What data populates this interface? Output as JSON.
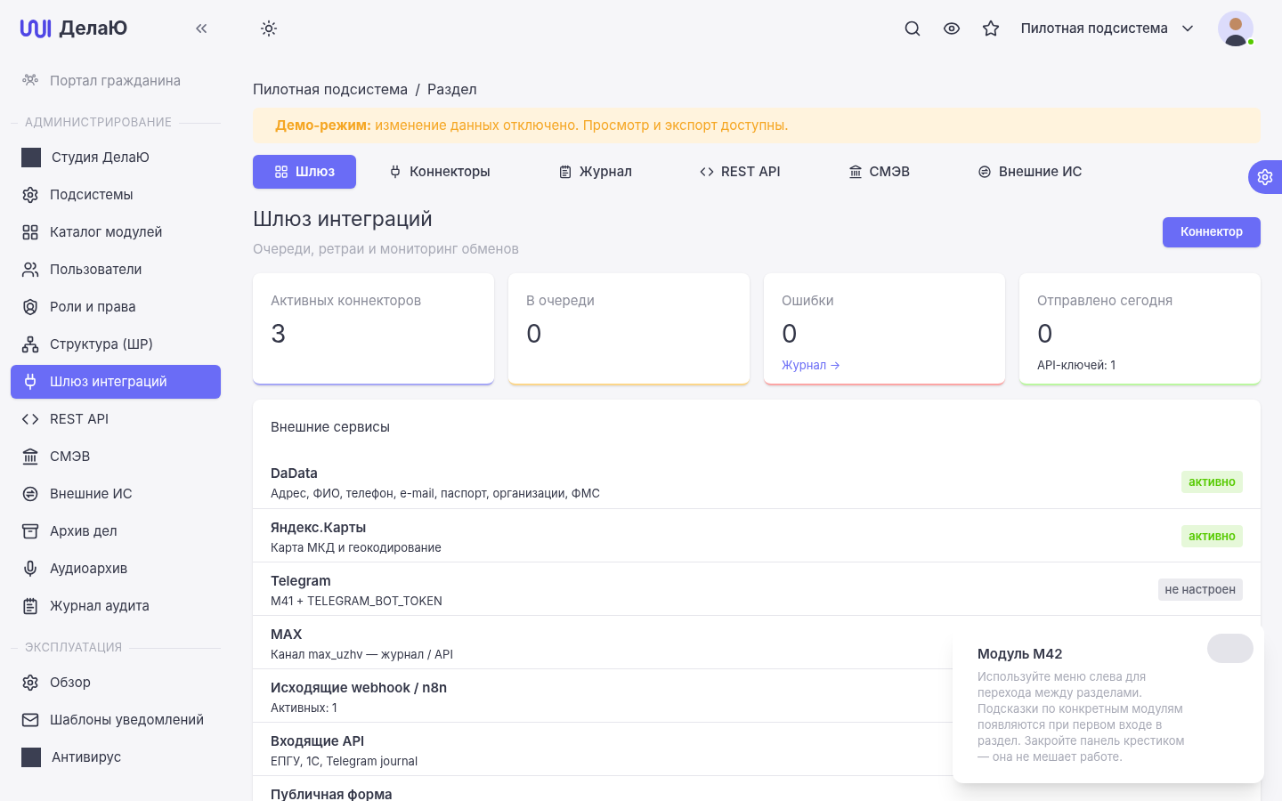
{
  "brand": {
    "name": "ДелаЮ"
  },
  "sidebar": {
    "top_item": {
      "label": "Портал гражданина"
    },
    "sections": [
      {
        "title": "АДМИНИСТРИРОВАНИЕ",
        "items": [
          {
            "label": "Студия ДелаЮ",
            "selected": false
          },
          {
            "label": "Подсистемы",
            "selected": false
          },
          {
            "label": "Каталог модулей",
            "selected": false
          },
          {
            "label": "Пользователи",
            "selected": false
          },
          {
            "label": "Роли и права",
            "selected": false
          },
          {
            "label": "Структура (ШР)",
            "selected": false
          },
          {
            "label": "Шлюз интеграций",
            "selected": true
          },
          {
            "label": "REST API",
            "selected": false
          },
          {
            "label": "СМЭВ",
            "selected": false
          },
          {
            "label": "Внешние ИС",
            "selected": false
          },
          {
            "label": "Архив дел",
            "selected": false
          },
          {
            "label": "Аудиоархив",
            "selected": false
          },
          {
            "label": "Журнал аудита",
            "selected": false
          }
        ]
      },
      {
        "title": "ЭКСПЛУАТАЦИЯ",
        "items": [
          {
            "label": "Обзор",
            "selected": false
          },
          {
            "label": "Шаблоны уведомлений",
            "selected": false
          },
          {
            "label": "Антивирус",
            "selected": false
          }
        ]
      }
    ]
  },
  "header": {
    "subsystem": "Пилотная подсистема",
    "user": {
      "online": true
    }
  },
  "breadcrumb": {
    "items": [
      "Пилотная подсистема",
      "Раздел"
    ],
    "separator": "/"
  },
  "alert": "**Демо-режим:** изменение данных отключено. Просмотр и экспорт доступны.",
  "tabs": [
    {
      "label": "Шлюз",
      "selected": true
    },
    {
      "label": "Коннекторы",
      "selected": false
    },
    {
      "label": "Журнал",
      "selected": false
    },
    {
      "label": "REST API",
      "selected": false
    },
    {
      "label": "СМЭВ",
      "selected": false
    },
    {
      "label": "Внешние ИС",
      "selected": false
    }
  ],
  "page": {
    "title": "Шлюз интеграций",
    "subtitle": "Очереди, ретраи и мониторинг обменов",
    "action": "Коннектор"
  },
  "stats": [
    {
      "label": "Активных коннекторов",
      "value": "3",
      "color": "#a5a6f6"
    },
    {
      "label": "В очереди",
      "value": "0",
      "color": "#fcd68a"
    },
    {
      "label": "Ошибки",
      "value": "0",
      "link": "Журнал →",
      "color": "#fca5a5"
    },
    {
      "label": "Отправлено сегодня",
      "value": "0",
      "note": "API-ключей: 1",
      "color": "#bbf7a0"
    }
  ],
  "services": {
    "title": "Внешние сервисы",
    "rows": [
      {
        "name": "DaData",
        "description": "Адрес, ФИО, телефон, e-mail, паспорт, организации, ФМС",
        "status": "активно",
        "active": true
      },
      {
        "name": "Яндекс.Карты",
        "description": "Карта МКД и геокодирование",
        "status": "активно",
        "active": true
      },
      {
        "name": "Telegram",
        "description": "M41 + TELEGRAM_BOT_TOKEN",
        "status": "не настроен",
        "active": false
      },
      {
        "name": "MAX",
        "description": "Канал max_uzhv — журнал / API"
      },
      {
        "name": "Исходящие webhook / n8n",
        "description": "Активных: 1"
      },
      {
        "name": "Входящие API",
        "description": "ЕПГУ, 1С, Telegram journal"
      },
      {
        "name": "Публичная форма"
      }
    ]
  },
  "tip": {
    "title": "Модуль M42",
    "text": "Используйте меню слева для перехода между разделами. Подсказки по конкретным модулям появляются при первом входе в раздел. Закройте панель крестиком — она не мешает работе."
  }
}
